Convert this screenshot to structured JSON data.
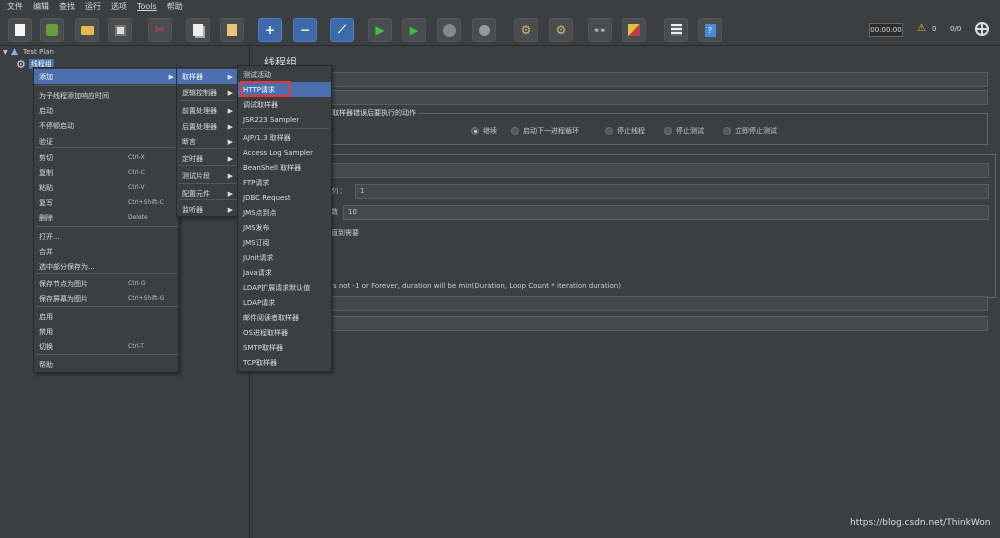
{
  "menubar": [
    "文件",
    "编辑",
    "查找",
    "运行",
    "选项",
    "Tools",
    "帮助"
  ],
  "toolbar": {
    "timer": "00:00:00",
    "warn_count": "0",
    "threads": "0/0"
  },
  "tree": {
    "root": "Test Plan",
    "child": "线程组"
  },
  "panel": {
    "title": "线程组",
    "error_group_title": "在取样器错误后要执行的动作",
    "radios": [
      "继续",
      "启动下一进程循环",
      "停止线程",
      "停止测试",
      "立即停止测试"
    ],
    "ramp_label": "秒）：",
    "ramp_value": "1",
    "loop_label": "数",
    "loop_value": "10",
    "delay_label": "直到需要",
    "duration_note": "s not -1 or Forever, duration will be min(Duration, Loop Count * iteration duration)"
  },
  "menu1": {
    "items": [
      {
        "label": "添加",
        "shortcut": "",
        "submenu": true
      },
      {
        "label": "为子线程添加响应时间",
        "shortcut": ""
      },
      {
        "label": "启动",
        "shortcut": ""
      },
      {
        "label": "不停顿启动",
        "shortcut": ""
      },
      {
        "label": "验证",
        "shortcut": ""
      },
      {
        "label": "剪切",
        "shortcut": "Ctrl-X"
      },
      {
        "label": "复制",
        "shortcut": "Ctrl-C"
      },
      {
        "label": "粘贴",
        "shortcut": "Ctrl-V"
      },
      {
        "label": "复写",
        "shortcut": "Ctrl+Shift-C"
      },
      {
        "label": "删除",
        "shortcut": "Delete"
      },
      {
        "label": "打开...",
        "shortcut": ""
      },
      {
        "label": "合并",
        "shortcut": ""
      },
      {
        "label": "选中部分保存为...",
        "shortcut": ""
      },
      {
        "label": "保存节点为图片",
        "shortcut": "Ctrl-G"
      },
      {
        "label": "保存屏幕为图片",
        "shortcut": "Ctrl+Shift-G"
      },
      {
        "label": "启用",
        "shortcut": ""
      },
      {
        "label": "禁用",
        "shortcut": ""
      },
      {
        "label": "切换",
        "shortcut": "Ctrl-T"
      },
      {
        "label": "帮助",
        "shortcut": ""
      }
    ]
  },
  "menu2": {
    "items": [
      "取样器",
      "逻辑控制器",
      "前置处理器",
      "后置处理器",
      "断言",
      "定时器",
      "测试片段",
      "配置元件",
      "监听器"
    ]
  },
  "menu3": {
    "items": [
      "测试活动",
      "HTTP请求",
      "调试取样器",
      "JSR223 Sampler",
      "AJP/1.3 取样器",
      "Access Log Sampler",
      "BeanShell 取样器",
      "FTP请求",
      "JDBC Request",
      "JMS点到点",
      "JMS发布",
      "JMS订阅",
      "JUnit请求",
      "Java请求",
      "LDAP扩展请求默认值",
      "LDAP请求",
      "邮件阅读者取样器",
      "OS进程取样器",
      "SMTP取样器",
      "TCP取样器"
    ]
  },
  "watermark": "https://blog.csdn.net/ThinkWon"
}
